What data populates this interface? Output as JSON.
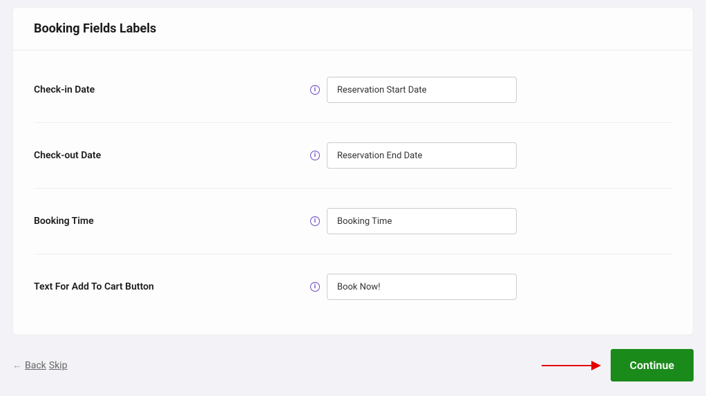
{
  "header": {
    "title": "Booking Fields Labels"
  },
  "fields": {
    "checkin": {
      "label": "Check-in Date",
      "value": "Reservation Start Date"
    },
    "checkout": {
      "label": "Check-out Date",
      "value": "Reservation End Date"
    },
    "time": {
      "label": "Booking Time",
      "value": "Booking Time"
    },
    "addtocart": {
      "label": "Text For Add To Cart Button",
      "value": "Book Now!"
    }
  },
  "footer": {
    "back": "Back",
    "skip": "Skip",
    "continue": "Continue"
  }
}
